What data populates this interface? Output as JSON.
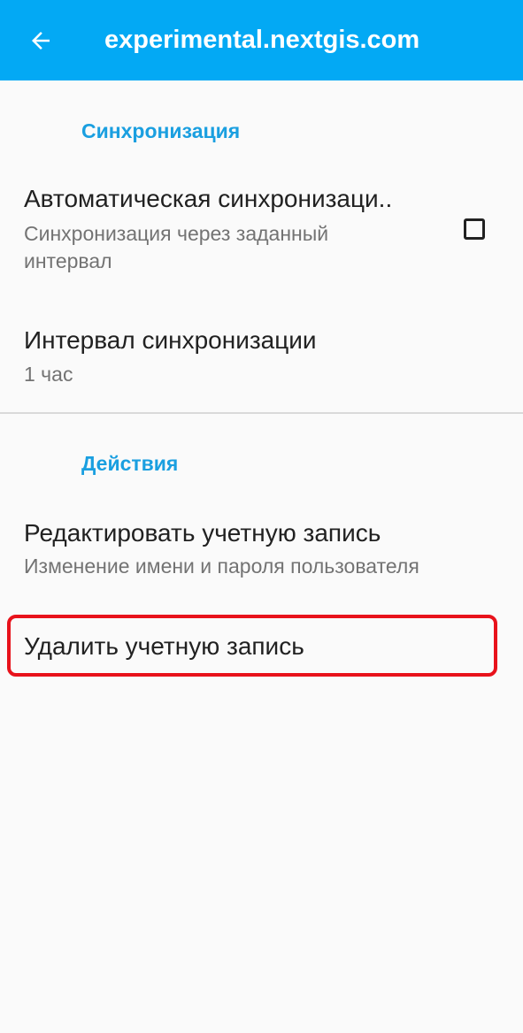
{
  "appbar": {
    "title": "experimental.nextgis.com",
    "back_icon": "arrow-left-icon",
    "background": "#03a9f4"
  },
  "sections": {
    "sync": {
      "header": "Синхронизация",
      "auto_sync": {
        "title": "Автоматическая синхронизаци..",
        "summary": "Синхронизация через заданный интервал",
        "checked": false
      },
      "interval": {
        "title": "Интервал синхронизации",
        "summary": "1 час"
      }
    },
    "actions": {
      "header": "Действия",
      "edit_account": {
        "title": "Редактировать учетную запись",
        "summary": "Изменение имени и пароля пользователя"
      },
      "delete_account": {
        "title": "Удалить учетную запись"
      }
    }
  },
  "colors": {
    "accent": "#1a9fe0",
    "highlight": "#e8121b"
  }
}
